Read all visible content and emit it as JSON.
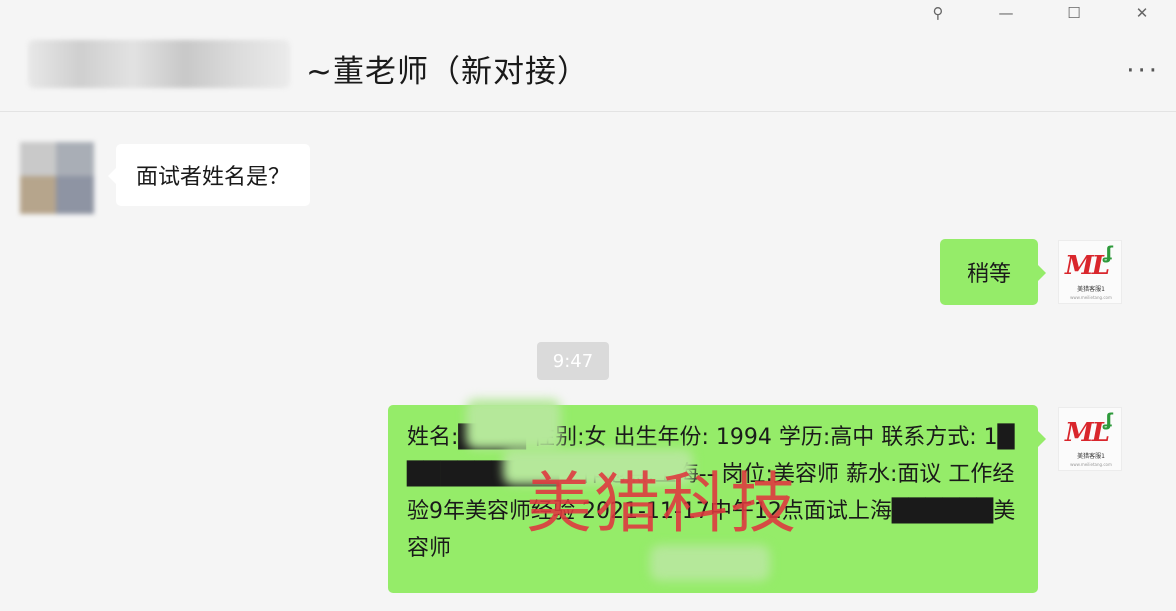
{
  "window": {
    "pin_icon": "pin-icon",
    "minimize_icon": "minimize-icon",
    "maximize_icon": "maximize-icon",
    "close_icon": "close-icon"
  },
  "header": {
    "title": "~董老师（新对接）",
    "more_icon": "more-icon"
  },
  "messages": [
    {
      "side": "left",
      "text": "面试者姓名是？"
    },
    {
      "side": "right",
      "text": "稍等"
    },
    {
      "type": "timestamp",
      "text": "9:47"
    },
    {
      "side": "right",
      "text": "姓名:████ 性别:女 出生年份: 1994 学历:高中 联系方式: 1██████████工作地点:上海-- 岗位:美容师 薪水:面议 工作经验9年美容师经验 2021-11-17中午12点面试上海██████美容师"
    }
  ],
  "watermark": "美猎科技",
  "avatar_right": {
    "logo_text": "ML",
    "caption": "美猎客服1",
    "subcaption": "www.meilietang.com"
  }
}
